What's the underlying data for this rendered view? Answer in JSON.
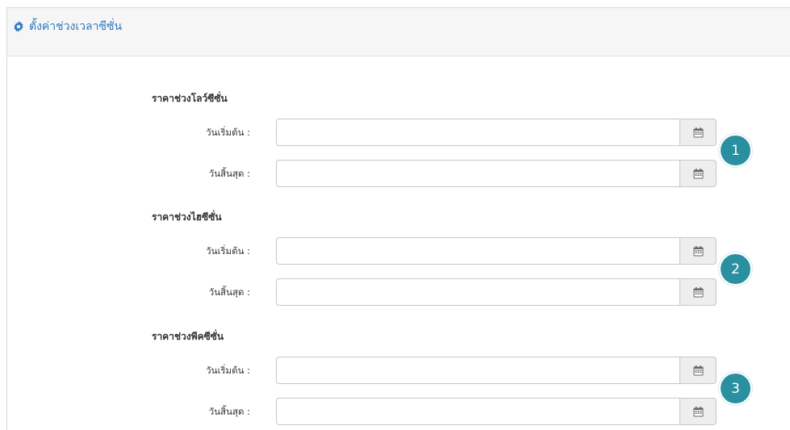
{
  "header": {
    "title": "ตั้งค่าช่วงเวลาซีซั่น",
    "icon": "gear-icon",
    "title_color": "#2b78c0"
  },
  "sections": [
    {
      "title": "ราคาช่วงโลว์ซีซั่น",
      "start_label": "วันเริ่มต้น :",
      "end_label": "วันสิ้นสุด :",
      "start_value": "",
      "end_value": "",
      "badge": "1"
    },
    {
      "title": "ราคาช่วงไฮซีซั่น",
      "start_label": "วันเริ่มต้น :",
      "end_label": "วันสิ้นสุด :",
      "start_value": "",
      "end_value": "",
      "badge": "2"
    },
    {
      "title": "ราคาช่วงพีคซีซั่น",
      "start_label": "วันเริ่มต้น :",
      "end_label": "วันสิ้นสุด :",
      "start_value": "",
      "end_value": "",
      "badge": "3"
    }
  ],
  "icons": {
    "calendar": "calendar-icon"
  },
  "colors": {
    "badge": "#2a8fa0",
    "accent": "#2b78c0"
  }
}
